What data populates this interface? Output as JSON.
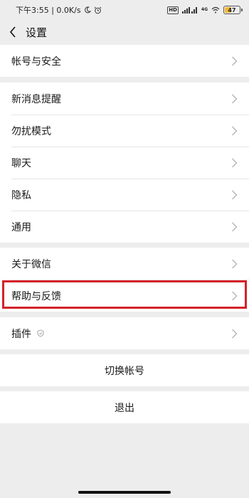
{
  "status_bar": {
    "time_network": "下午3:55 | 0.0K/s",
    "hd_label": "HD",
    "network_label": "4G",
    "battery": "47",
    "battery_level": 0.47
  },
  "header": {
    "title": "设置"
  },
  "groups": [
    {
      "items": [
        {
          "label": "帐号与安全"
        }
      ]
    },
    {
      "items": [
        {
          "label": "新消息提醒"
        },
        {
          "label": "勿扰模式"
        },
        {
          "label": "聊天"
        },
        {
          "label": "隐私"
        },
        {
          "label": "通用"
        }
      ]
    },
    {
      "items": [
        {
          "label": "关于微信"
        },
        {
          "label": "帮助与反馈",
          "highlighted": true
        }
      ]
    },
    {
      "items": [
        {
          "label": "插件",
          "icon": "shield-icon"
        }
      ]
    }
  ],
  "buttons": {
    "switch_account": "切换帐号",
    "logout": "退出"
  },
  "colors": {
    "background": "#ededed",
    "highlight": "#d3222a"
  }
}
